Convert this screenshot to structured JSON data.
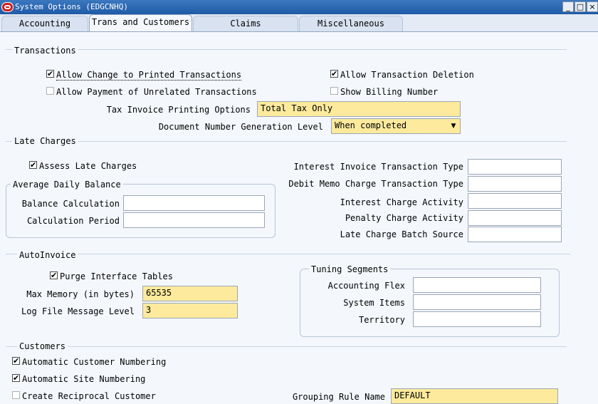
{
  "window": {
    "title": "System Options (EDGCNHQ)",
    "buttons": {
      "minimize": "_",
      "maximize": "□",
      "close": "×"
    }
  },
  "tabs": [
    {
      "label": "Accounting"
    },
    {
      "label": "Trans and Customers"
    },
    {
      "label": "Claims"
    },
    {
      "label": "Miscellaneous"
    }
  ],
  "transactions": {
    "heading": "Transactions",
    "allow_change_printed": {
      "label": "Allow Change to Printed Transactions",
      "checked": true
    },
    "allow_payment_unrelated": {
      "label": "Allow Payment of Unrelated Transactions",
      "checked": false
    },
    "allow_deletion": {
      "label": "Allow Transaction Deletion",
      "checked": true
    },
    "show_billing_number": {
      "label": "Show Billing Number",
      "checked": false
    },
    "tax_invoice_label": "Tax Invoice Printing Options",
    "tax_invoice_value": "Total Tax Only",
    "doc_num_label": "Document Number Generation Level",
    "doc_num_value": "When completed"
  },
  "late_charges": {
    "heading": "Late Charges",
    "assess": {
      "label": "Assess Late Charges",
      "checked": true
    },
    "adb_heading": "Average Daily Balance",
    "balance_calc_label": "Balance Calculation",
    "balance_calc_value": "",
    "calc_period_label": "Calculation Period",
    "calc_period_value": "",
    "interest_invoice_label": "Interest Invoice Transaction Type",
    "debit_memo_label": "Debit Memo Charge Transaction Type",
    "interest_activity_label": "Interest Charge Activity",
    "penalty_activity_label": "Penalty Charge Activity",
    "batch_source_label": "Late Charge Batch Source"
  },
  "autoinvoice": {
    "heading": "AutoInvoice",
    "purge": {
      "label": "Purge Interface Tables",
      "checked": true
    },
    "max_memory_label": "Max Memory (in bytes)",
    "max_memory_value": "65535",
    "log_level_label": "Log File Message Level",
    "log_level_value": "3",
    "tuning_heading": "Tuning Segments",
    "accounting_flex_label": "Accounting Flex",
    "system_items_label": "System Items",
    "territory_label": "Territory"
  },
  "customers": {
    "heading": "Customers",
    "auto_customer_numbering": {
      "label": "Automatic Customer Numbering",
      "checked": true
    },
    "auto_site_numbering": {
      "label": "Automatic Site Numbering",
      "checked": true
    },
    "create_reciprocal": {
      "label": "Create Reciprocal Customer",
      "checked": false
    },
    "grouping_rule_label": "Grouping Rule Name",
    "grouping_rule_value": "DEFAULT"
  },
  "colors": {
    "title_bar": "#1f5aa6",
    "required_field": "#fdea9c",
    "background": "#f4f7fc"
  },
  "icons": {
    "logo": "oracle-logo-icon",
    "dropdown": "triangle-down"
  }
}
